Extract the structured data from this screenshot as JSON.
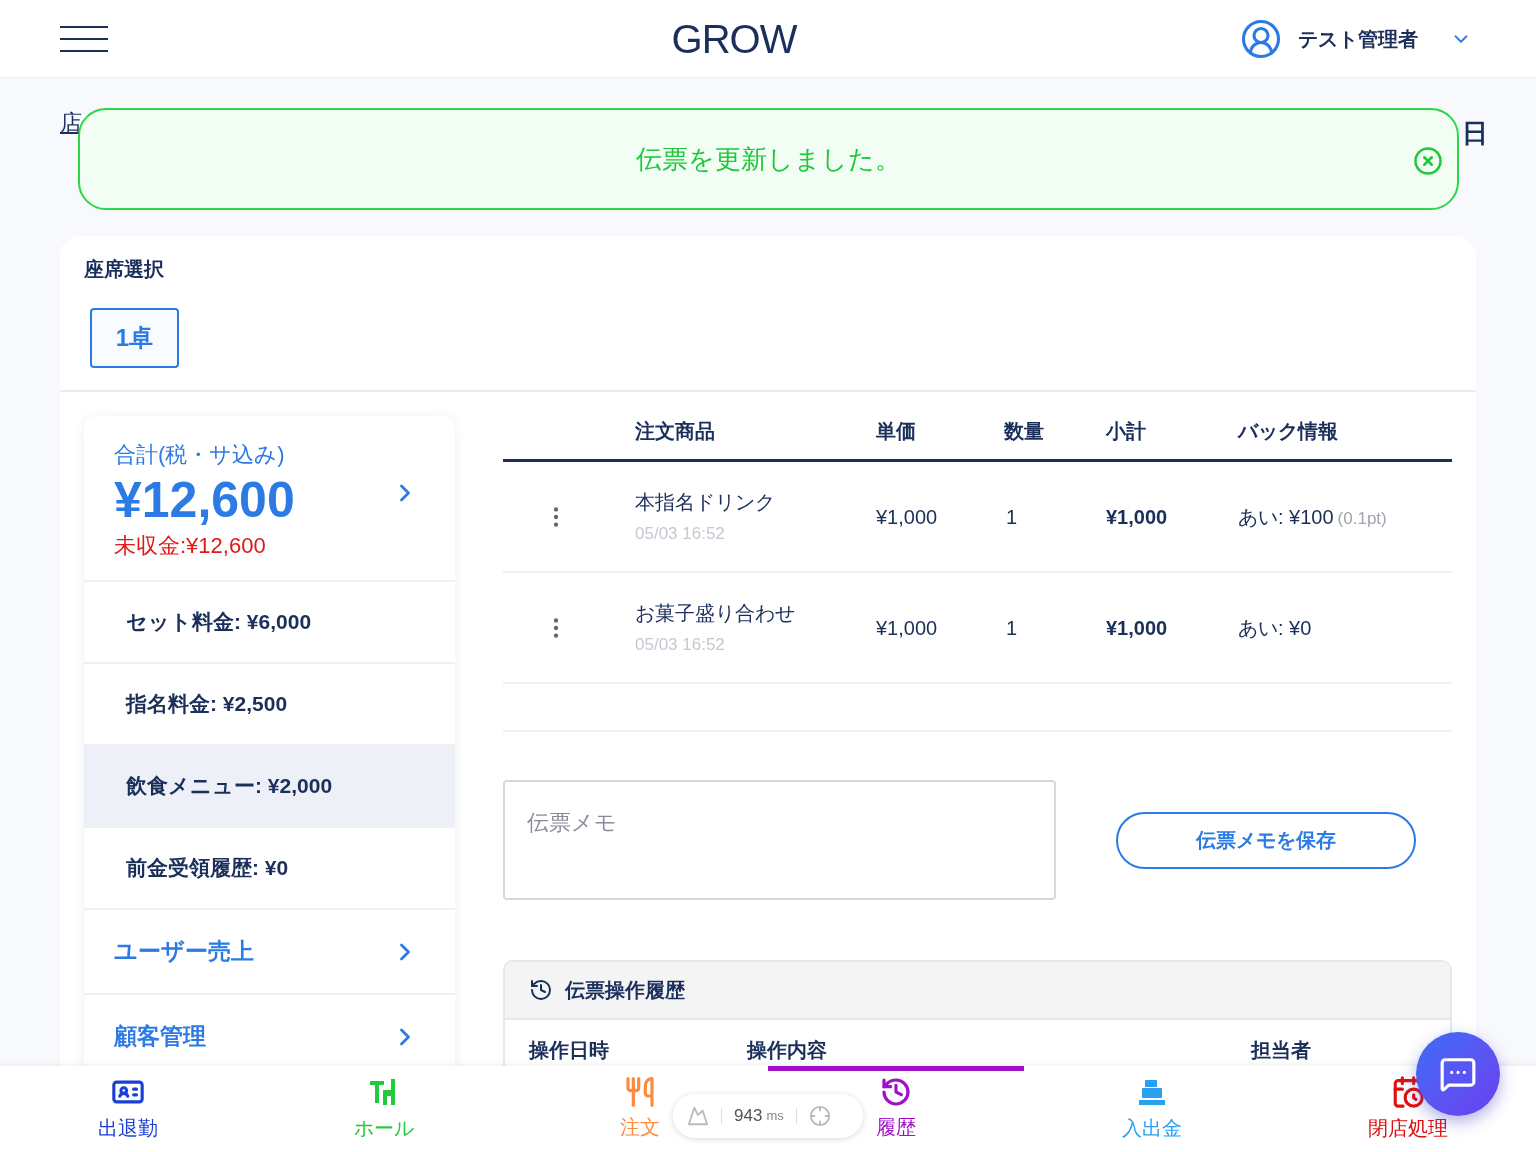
{
  "header": {
    "logo": "GROW",
    "user": "テスト管理者"
  },
  "page": {
    "breadcrumb": "店",
    "date": "日"
  },
  "toast": {
    "message": "伝票を更新しました。"
  },
  "seats": {
    "label": "座席選択",
    "items": [
      {
        "label": "1卓",
        "selected": true
      }
    ]
  },
  "summary": {
    "total_label": "合計(税・サ込み)",
    "total": "¥12,600",
    "unpaid": "未収金:¥12,600",
    "items": [
      {
        "kind": "amount",
        "label": "セット料金: ¥6,000",
        "selected": false
      },
      {
        "kind": "amount",
        "label": "指名料金: ¥2,500",
        "selected": false
      },
      {
        "kind": "amount",
        "label": "飲食メニュー: ¥2,000",
        "selected": true
      },
      {
        "kind": "amount",
        "label": "前金受領履歴: ¥0",
        "selected": false
      },
      {
        "kind": "link",
        "label": "ユーザー売上",
        "selected": false
      },
      {
        "kind": "link",
        "label": "顧客管理",
        "selected": false
      }
    ]
  },
  "orders": {
    "columns": [
      "注文商品",
      "単価",
      "数量",
      "小計",
      "バック情報"
    ],
    "rows": [
      {
        "name": "本指名ドリンク",
        "time": "05/03 16:52",
        "price": "¥1,000",
        "qty": "1",
        "subtotal": "¥1,000",
        "back": "あい: ¥100",
        "back_note": "(0.1pt)"
      },
      {
        "name": "お菓子盛り合わせ",
        "time": "05/03 16:52",
        "price": "¥1,000",
        "qty": "1",
        "subtotal": "¥1,000",
        "back": "あい: ¥0"
      }
    ]
  },
  "memo": {
    "placeholder": "伝票メモ",
    "button": "伝票メモを保存"
  },
  "history": {
    "title": "伝票操作履歴",
    "columns": [
      "操作日時",
      "操作内容",
      "担当者"
    ]
  },
  "perf": {
    "value": "943",
    "unit": "ms"
  },
  "bottom_nav": [
    {
      "label": "出退勤",
      "color": "#1a3fd6",
      "selected": false
    },
    {
      "label": "ホール",
      "color": "#22c93a",
      "selected": false
    },
    {
      "label": "注文",
      "color": "#ff8a3d",
      "selected": false
    },
    {
      "label": "履歴",
      "color": "#a010c8",
      "selected": true
    },
    {
      "label": "入出金",
      "color": "#2aa0f0",
      "selected": false
    },
    {
      "label": "閉店処理",
      "color": "#e01010",
      "selected": false
    }
  ]
}
